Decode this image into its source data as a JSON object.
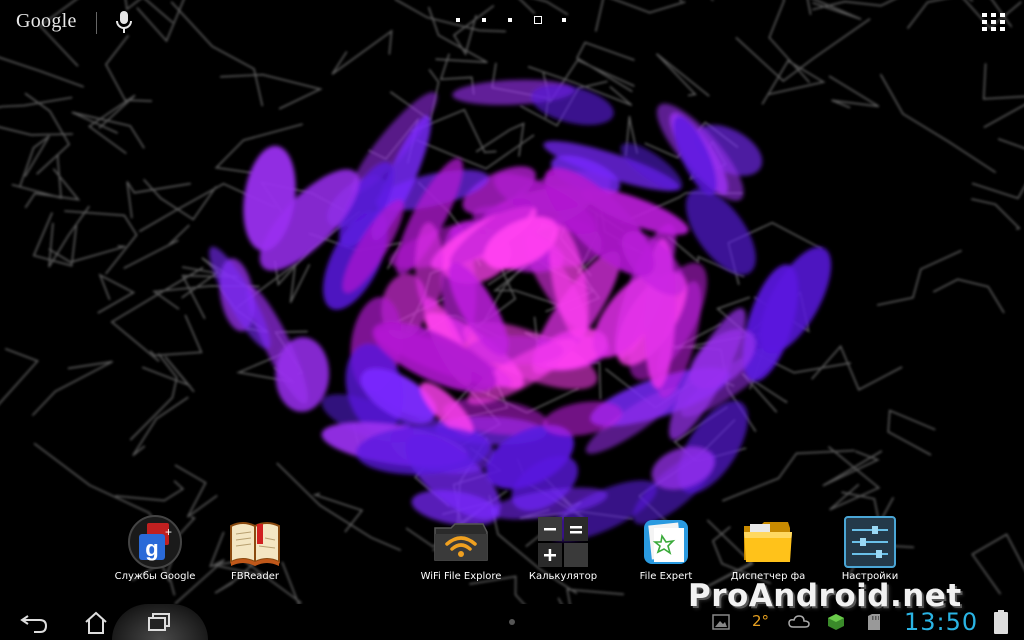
{
  "topbar": {
    "search_logo": "Google",
    "mic_icon": "microphone-icon",
    "pages": {
      "count": 5,
      "current": 4
    },
    "all_apps_icon": "grid-icon"
  },
  "dock": {
    "apps": [
      {
        "label": "Службы Google",
        "icon": "google-services-icon"
      },
      {
        "label": "FBReader",
        "icon": "book-icon"
      },
      {
        "label": "WiFi File Explore",
        "icon": "wifi-folder-icon"
      },
      {
        "label": "Калькулятор",
        "icon": "calculator-icon"
      },
      {
        "label": "File Expert",
        "icon": "file-expert-icon"
      },
      {
        "label": "Диспетчер фа",
        "icon": "folder-icon"
      },
      {
        "label": "Настройки",
        "icon": "settings-icon"
      }
    ]
  },
  "navbar": {
    "buttons": [
      "back-icon",
      "home-icon",
      "recent-apps-icon"
    ],
    "watermark": "ProAndroid.net",
    "status": {
      "temperature": "2°",
      "time": "13:50",
      "icons": [
        "gallery-icon",
        "weather-cloud-icon",
        "android-debug-icon",
        "sd-card-icon",
        "battery-icon"
      ]
    }
  },
  "colors": {
    "clock": "#2ab4e4",
    "temperature": "#e6a020",
    "wallpaper_accent": "#e020e0"
  }
}
